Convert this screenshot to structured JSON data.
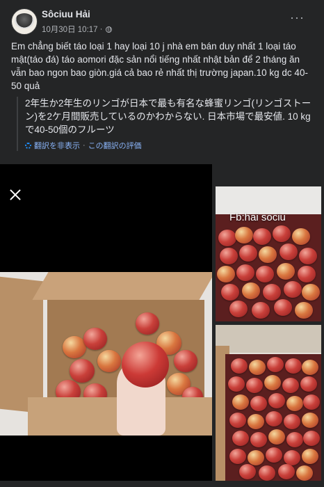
{
  "post": {
    "author": "Sôciuu Hải",
    "date": "10月30日 10:17",
    "separator": "·",
    "body": "Em chẳng biết táo loại 1 hay loại 10 j nhà em bán duy nhất 1 loại táo mật(táo đá) táo aomori đặc sản nổi tiếng nhất nhật bản để 2 tháng ăn vẫn bao ngon bao giòn.giá cả bao rẻ nhất thị trường japan.10 kg dc 40-50 quả",
    "translation": "2年生か2年生のリンゴが日本で最も有名な蜂蜜リンゴ(リンゴストーン)を2ケ月間販売しているのかわからない. 日本市場で最安値. 10 kgで40-50個のフルーツ",
    "hide_translation": "翻訳を非表示",
    "rate_translation": "この翻訳の評価",
    "link_separator": "·",
    "watermark": "Fb:hai sociu"
  },
  "icons": {
    "privacy": "globe-icon",
    "more": "more-icon",
    "close": "close-icon",
    "translate_settings": "gear-icon"
  },
  "colors": {
    "background": "#242526",
    "text": "#e4e6eb",
    "muted": "#b0b3b8",
    "link": "#8ab4f8"
  }
}
